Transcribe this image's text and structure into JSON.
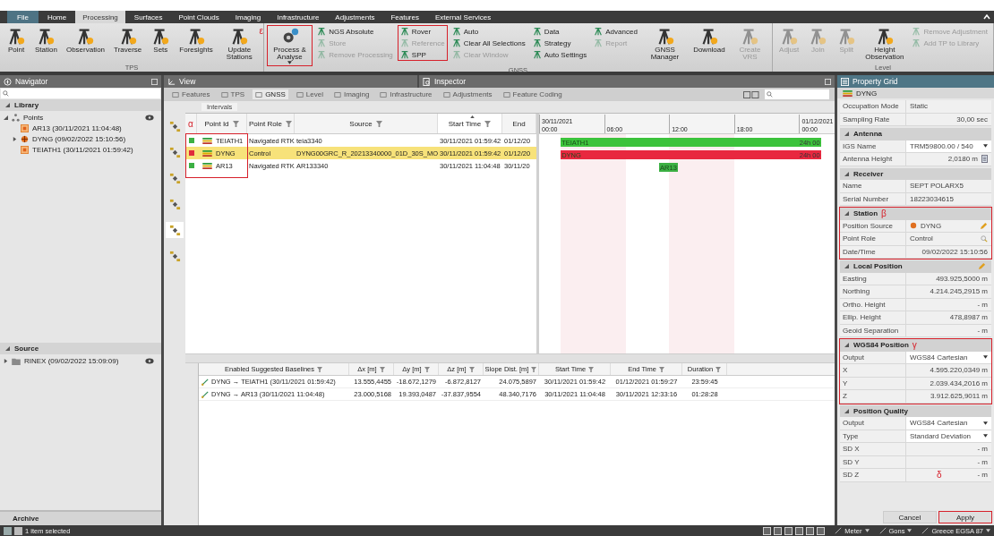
{
  "ribbon": {
    "tabs": [
      {
        "label": "File",
        "kind": "file",
        "selected": false
      },
      {
        "label": "Home",
        "kind": "tab",
        "selected": false
      },
      {
        "label": "Processing",
        "kind": "tab",
        "selected": true
      },
      {
        "label": "Surfaces",
        "kind": "tab",
        "selected": false
      },
      {
        "label": "Point Clouds",
        "kind": "tab",
        "selected": false
      },
      {
        "label": "Imaging",
        "kind": "tab",
        "selected": false
      },
      {
        "label": "Infrastructure",
        "kind": "tab",
        "selected": false
      },
      {
        "label": "Adjustments",
        "kind": "tab",
        "selected": false
      },
      {
        "label": "Features",
        "kind": "tab",
        "selected": false
      },
      {
        "label": "External Services",
        "kind": "tab",
        "selected": false
      }
    ],
    "groups": [
      {
        "label": "TPS",
        "items": [
          {
            "kind": "large",
            "label": "Point",
            "disabled": false,
            "marked": false
          },
          {
            "kind": "large",
            "label": "Station",
            "disabled": false,
            "marked": false
          },
          {
            "kind": "large",
            "label": "Observation",
            "disabled": false,
            "marked": false
          },
          {
            "kind": "large",
            "label": "Traverse",
            "disabled": false,
            "marked": false
          },
          {
            "kind": "large",
            "label": "Sets",
            "disabled": false,
            "marked": false
          },
          {
            "kind": "large",
            "label": "Foresights",
            "disabled": false,
            "marked": false
          },
          {
            "kind": "large",
            "label": "Update Stations",
            "disabled": false,
            "marked": false,
            "note": "ε"
          }
        ]
      },
      {
        "label": "GNSS",
        "items": [
          {
            "kind": "large",
            "label": "Process & Analyse",
            "disabled": false,
            "marked": true,
            "dropdown": true
          },
          {
            "kind": "stack",
            "marked": false,
            "rows": [
              {
                "label": "NGS Absolute",
                "disabled": false
              },
              {
                "label": "Store",
                "disabled": true
              },
              {
                "label": "Remove Processing",
                "disabled": true
              }
            ]
          },
          {
            "kind": "stack",
            "marked": true,
            "rows": [
              {
                "label": "Rover",
                "disabled": false
              },
              {
                "label": "Reference",
                "disabled": true
              },
              {
                "label": "SPP",
                "disabled": false
              }
            ]
          },
          {
            "kind": "stack",
            "marked": false,
            "rows": [
              {
                "label": "Auto",
                "disabled": false
              },
              {
                "label": "Clear All Selections",
                "disabled": false
              },
              {
                "label": "Clear Window",
                "disabled": true
              }
            ]
          },
          {
            "kind": "stack",
            "marked": false,
            "rows": [
              {
                "label": "Data",
                "disabled": false
              },
              {
                "label": "Strategy",
                "disabled": false
              },
              {
                "label": "Auto Settings",
                "disabled": false
              }
            ]
          },
          {
            "kind": "stack",
            "marked": false,
            "rows": [
              {
                "label": "Advanced",
                "disabled": false
              },
              {
                "label": "Report",
                "disabled": true
              }
            ]
          },
          {
            "kind": "large",
            "label": "GNSS Manager",
            "disabled": false,
            "marked": false
          },
          {
            "kind": "large",
            "label": "Download",
            "disabled": false,
            "marked": false
          },
          {
            "kind": "large",
            "label": "Create VRS",
            "disabled": true,
            "marked": false
          }
        ]
      },
      {
        "label": "Level",
        "items": [
          {
            "kind": "large",
            "label": "Adjust",
            "disabled": true,
            "marked": false
          },
          {
            "kind": "large",
            "label": "Join",
            "disabled": true,
            "marked": false
          },
          {
            "kind": "large",
            "label": "Split",
            "disabled": true,
            "marked": false
          },
          {
            "kind": "large",
            "label": "Height Observation",
            "disabled": false,
            "marked": false
          },
          {
            "kind": "stack",
            "marked": false,
            "rows": [
              {
                "label": "Remove Adjustment",
                "disabled": true
              },
              {
                "label": "Add TP to Library",
                "disabled": true
              }
            ]
          }
        ]
      }
    ]
  },
  "navigator": {
    "title": "Navigator",
    "library": {
      "title": "Library",
      "tree": [
        {
          "label": "Points",
          "kind": "group",
          "expanded": true,
          "visible": true,
          "children": [
            {
              "label": "AR13 (30/11/2021 11:04:48)",
              "kind": "point",
              "visible": false
            },
            {
              "label": "DYNG (09/02/2022 15:10:56)",
              "kind": "control",
              "expanded": false,
              "visible": false
            },
            {
              "label": "TEIATH1 (30/11/2021 01:59:42)",
              "kind": "point",
              "visible": false
            }
          ]
        }
      ]
    },
    "source": {
      "title": "Source",
      "tree": [
        {
          "label": "RINEX (09/02/2022 15:09:09)",
          "kind": "folder",
          "expanded": false,
          "visible": true
        }
      ]
    },
    "archive": "Archive"
  },
  "inspector": {
    "view_title": "View",
    "title": "Inspector",
    "tabs": [
      {
        "label": "Features",
        "selected": false
      },
      {
        "label": "TPS",
        "selected": false
      },
      {
        "label": "GNSS",
        "selected": true
      },
      {
        "label": "Level",
        "selected": false
      },
      {
        "label": "Imaging",
        "selected": false
      },
      {
        "label": "Infrastructure",
        "selected": false
      },
      {
        "label": "Adjustments",
        "selected": false
      },
      {
        "label": "Feature Coding",
        "selected": false
      }
    ],
    "breadcrumb": "Intervals",
    "side_tools": [
      {
        "selected": false
      },
      {
        "selected": false
      },
      {
        "selected": false
      },
      {
        "selected": false
      },
      {
        "selected": true
      },
      {
        "selected": false
      }
    ],
    "columns": [
      {
        "label": "α",
        "filter": false,
        "sorted": false
      },
      {
        "label": "Point Id",
        "filter": true,
        "sorted": false
      },
      {
        "label": "Point Role",
        "filter": true,
        "sorted": false
      },
      {
        "label": "Source",
        "filter": true,
        "sorted": false
      },
      {
        "label": "Start Time",
        "filter": true,
        "sorted": true
      },
      {
        "label": "End",
        "filter": false,
        "sorted": false
      }
    ],
    "rows_marked": true,
    "rows": [
      {
        "color": "#3cb043",
        "point_id": "TEIATH1",
        "role": "Navigated RTK",
        "source": "teia3340",
        "start": "30/11/2021 01:59:42",
        "end": "01/12/20",
        "selected": false
      },
      {
        "color": "#e02a3c",
        "point_id": "DYNG",
        "role": "Control",
        "source": "DYNG00GRC_R_20213340000_01D_30S_MO",
        "start": "30/11/2021 01:59:42",
        "end": "01/12/20",
        "selected": true
      },
      {
        "color": "#3cb043",
        "point_id": "AR13",
        "role": "Navigated RTK",
        "source": "AR133340",
        "start": "30/11/2021 11:04:48",
        "end": "30/11/20",
        "selected": false
      }
    ],
    "timeline": {
      "ticks": [
        {
          "date": "30/11/2021",
          "time": "00:00"
        },
        {
          "time": "06:00"
        },
        {
          "time": "12:00"
        },
        {
          "time": "18:00"
        },
        {
          "date": "01/12/2021",
          "time": "00:00"
        }
      ],
      "bars": [
        {
          "label": "TEIATH1",
          "color": "#3cc33c",
          "level": 0.95,
          "duration": "24h 00"
        },
        {
          "label": "DYNG",
          "color": "#e8283f",
          "level": 0.95,
          "duration": "24h 00"
        },
        {
          "label": "AR13",
          "color": "#3cb043"
        }
      ]
    },
    "baselines": {
      "columns": [
        {
          "label": "Enabled Suggested Baselines"
        },
        {
          "label": "Δx [m]"
        },
        {
          "label": "Δy [m]"
        },
        {
          "label": "Δz [m]"
        },
        {
          "label": "Slope Dist. [m]"
        },
        {
          "label": "Start Time"
        },
        {
          "label": "End Time"
        },
        {
          "label": "Duration"
        }
      ],
      "rows": [
        [
          "DYNG → TEIATH1 (30/11/2021 01:59:42)",
          "13.555,4455",
          "-18.672,1279",
          "-6.872,8127",
          "24.075,5897",
          "30/11/2021 01:59:42",
          "01/12/2021 01:59:27",
          "23:59:45"
        ],
        [
          "DYNG → AR13 (30/11/2021 11:04:48)",
          "23.000,5168",
          "19.393,0487",
          "-37.837,9554",
          "48.340,7176",
          "30/11/2021 11:04:48",
          "30/11/2021 12:33:16",
          "01:28:28"
        ]
      ]
    }
  },
  "property_grid": {
    "title": "Property Grid",
    "object": "DYNG",
    "sections": [
      {
        "rows": [
          {
            "label": "Occupation Mode",
            "value": "Static",
            "kind": "text"
          },
          {
            "label": "Sampling Rate",
            "value": "30,00 sec",
            "kind": "number"
          }
        ]
      },
      {
        "title": "Antenna",
        "rows": [
          {
            "label": "IGS Name",
            "value": "TRM59800.00 / 540",
            "kind": "dropdown"
          },
          {
            "label": "Antenna Height",
            "value": "2,0180 m",
            "kind": "calc"
          }
        ]
      },
      {
        "title": "Receiver",
        "rows": [
          {
            "label": "Name",
            "value": "SEPT POLARX5",
            "kind": "text"
          },
          {
            "label": "Serial Number",
            "value": "18223034615",
            "kind": "text"
          }
        ]
      },
      {
        "title": "Station",
        "marked": true,
        "note": "β",
        "rows": [
          {
            "label": "Position Source",
            "value": "DYNG",
            "kind": "point"
          },
          {
            "label": "Point Role",
            "value": "Control",
            "kind": "picker"
          },
          {
            "label": "Date/Time",
            "value": "09/02/2022 15:10:56",
            "kind": "number"
          }
        ]
      },
      {
        "title": "Local Position",
        "edit": true,
        "rows": [
          {
            "label": "Easting",
            "value": "493.925,5000 m",
            "kind": "number"
          },
          {
            "label": "Northing",
            "value": "4.214.245,2915 m",
            "kind": "number"
          },
          {
            "label": "Ortho. Height",
            "value": "- m",
            "kind": "number"
          },
          {
            "label": "Ellip. Height",
            "value": "478,8987 m",
            "kind": "number"
          },
          {
            "label": "Geoid Separation",
            "value": "- m",
            "kind": "number"
          }
        ]
      },
      {
        "title": "WGS84 Position",
        "marked": true,
        "note": "γ",
        "rows": [
          {
            "label": "Output",
            "value": "WGS84 Cartesian",
            "kind": "dropdown"
          },
          {
            "label": "X",
            "value": "4.595.220,0349 m",
            "kind": "number"
          },
          {
            "label": "Y",
            "value": "2.039.434,2016 m",
            "kind": "number"
          },
          {
            "label": "Z",
            "value": "3.912.625,9011 m",
            "kind": "number"
          }
        ]
      },
      {
        "title": "Position Quality",
        "rows": [
          {
            "label": "Output",
            "value": "WGS84 Cartesian",
            "kind": "dropdown"
          },
          {
            "label": "Type",
            "value": "Standard Deviation",
            "kind": "dropdown"
          },
          {
            "label": "SD X",
            "value": "- m",
            "kind": "number"
          },
          {
            "label": "SD Y",
            "value": "- m",
            "kind": "number"
          },
          {
            "label": "SD Z",
            "value": "- m",
            "kind": "number",
            "note": "δ"
          }
        ]
      }
    ],
    "buttons": [
      {
        "label": "Cancel",
        "marked": false
      },
      {
        "label": "Apply",
        "marked": true
      }
    ]
  },
  "status_bar": {
    "text": "1 item selected",
    "units": [
      "Meter",
      "Gons",
      "Greece EGSA 87"
    ]
  }
}
